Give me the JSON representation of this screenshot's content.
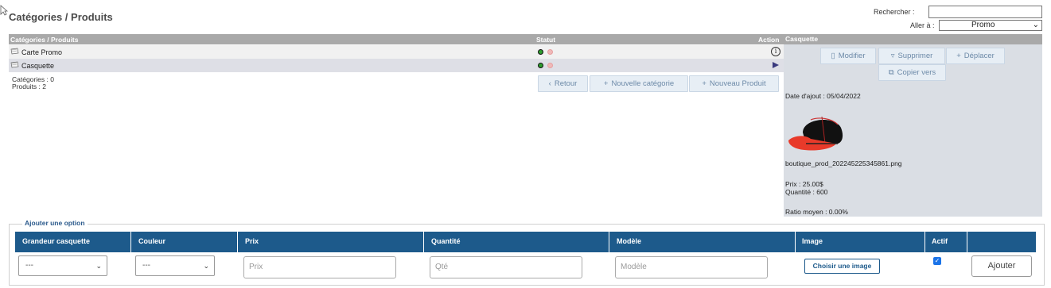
{
  "page": {
    "title": "Catégories / Produits"
  },
  "search": {
    "label": "Rechercher :",
    "value": ""
  },
  "goto": {
    "label": "Aller à :",
    "selected": "Promo"
  },
  "list": {
    "headers": {
      "name": "Catégories / Produits",
      "status": "Statut",
      "action": "Action"
    },
    "rows": [
      {
        "name": "Carte Promo"
      },
      {
        "name": "Casquette"
      }
    ],
    "counts": {
      "categories": "Catégories : 0",
      "products": "Produits : 2"
    }
  },
  "buttons": {
    "back": "Retour",
    "new_category": "Nouvelle catégorie",
    "new_product": "Nouveau Produit"
  },
  "panel": {
    "title": "Casquette",
    "actions": {
      "edit": "Modifier",
      "delete": "Supprimer",
      "move": "Déplacer",
      "copy": "Copier vers"
    },
    "date_added": "Date d'ajout : 05/04/2022",
    "image_name": "boutique_prod_202245225345861.png",
    "price": "Prix : 25.00$",
    "quantity": "Quantité : 600",
    "ratio": "Ratio moyen : 0.00%"
  },
  "option_form": {
    "legend": "Ajouter une option",
    "columns": [
      "Grandeur casquette",
      "Couleur",
      "Prix",
      "Quantité",
      "Modèle",
      "Image",
      "Actif"
    ],
    "size_value": "---",
    "color_value": "---",
    "price_placeholder": "Prix",
    "qty_placeholder": "Qté",
    "model_placeholder": "Modèle",
    "choose_image": "Choisir une image",
    "active_checked": true,
    "add_label": "Ajouter"
  }
}
